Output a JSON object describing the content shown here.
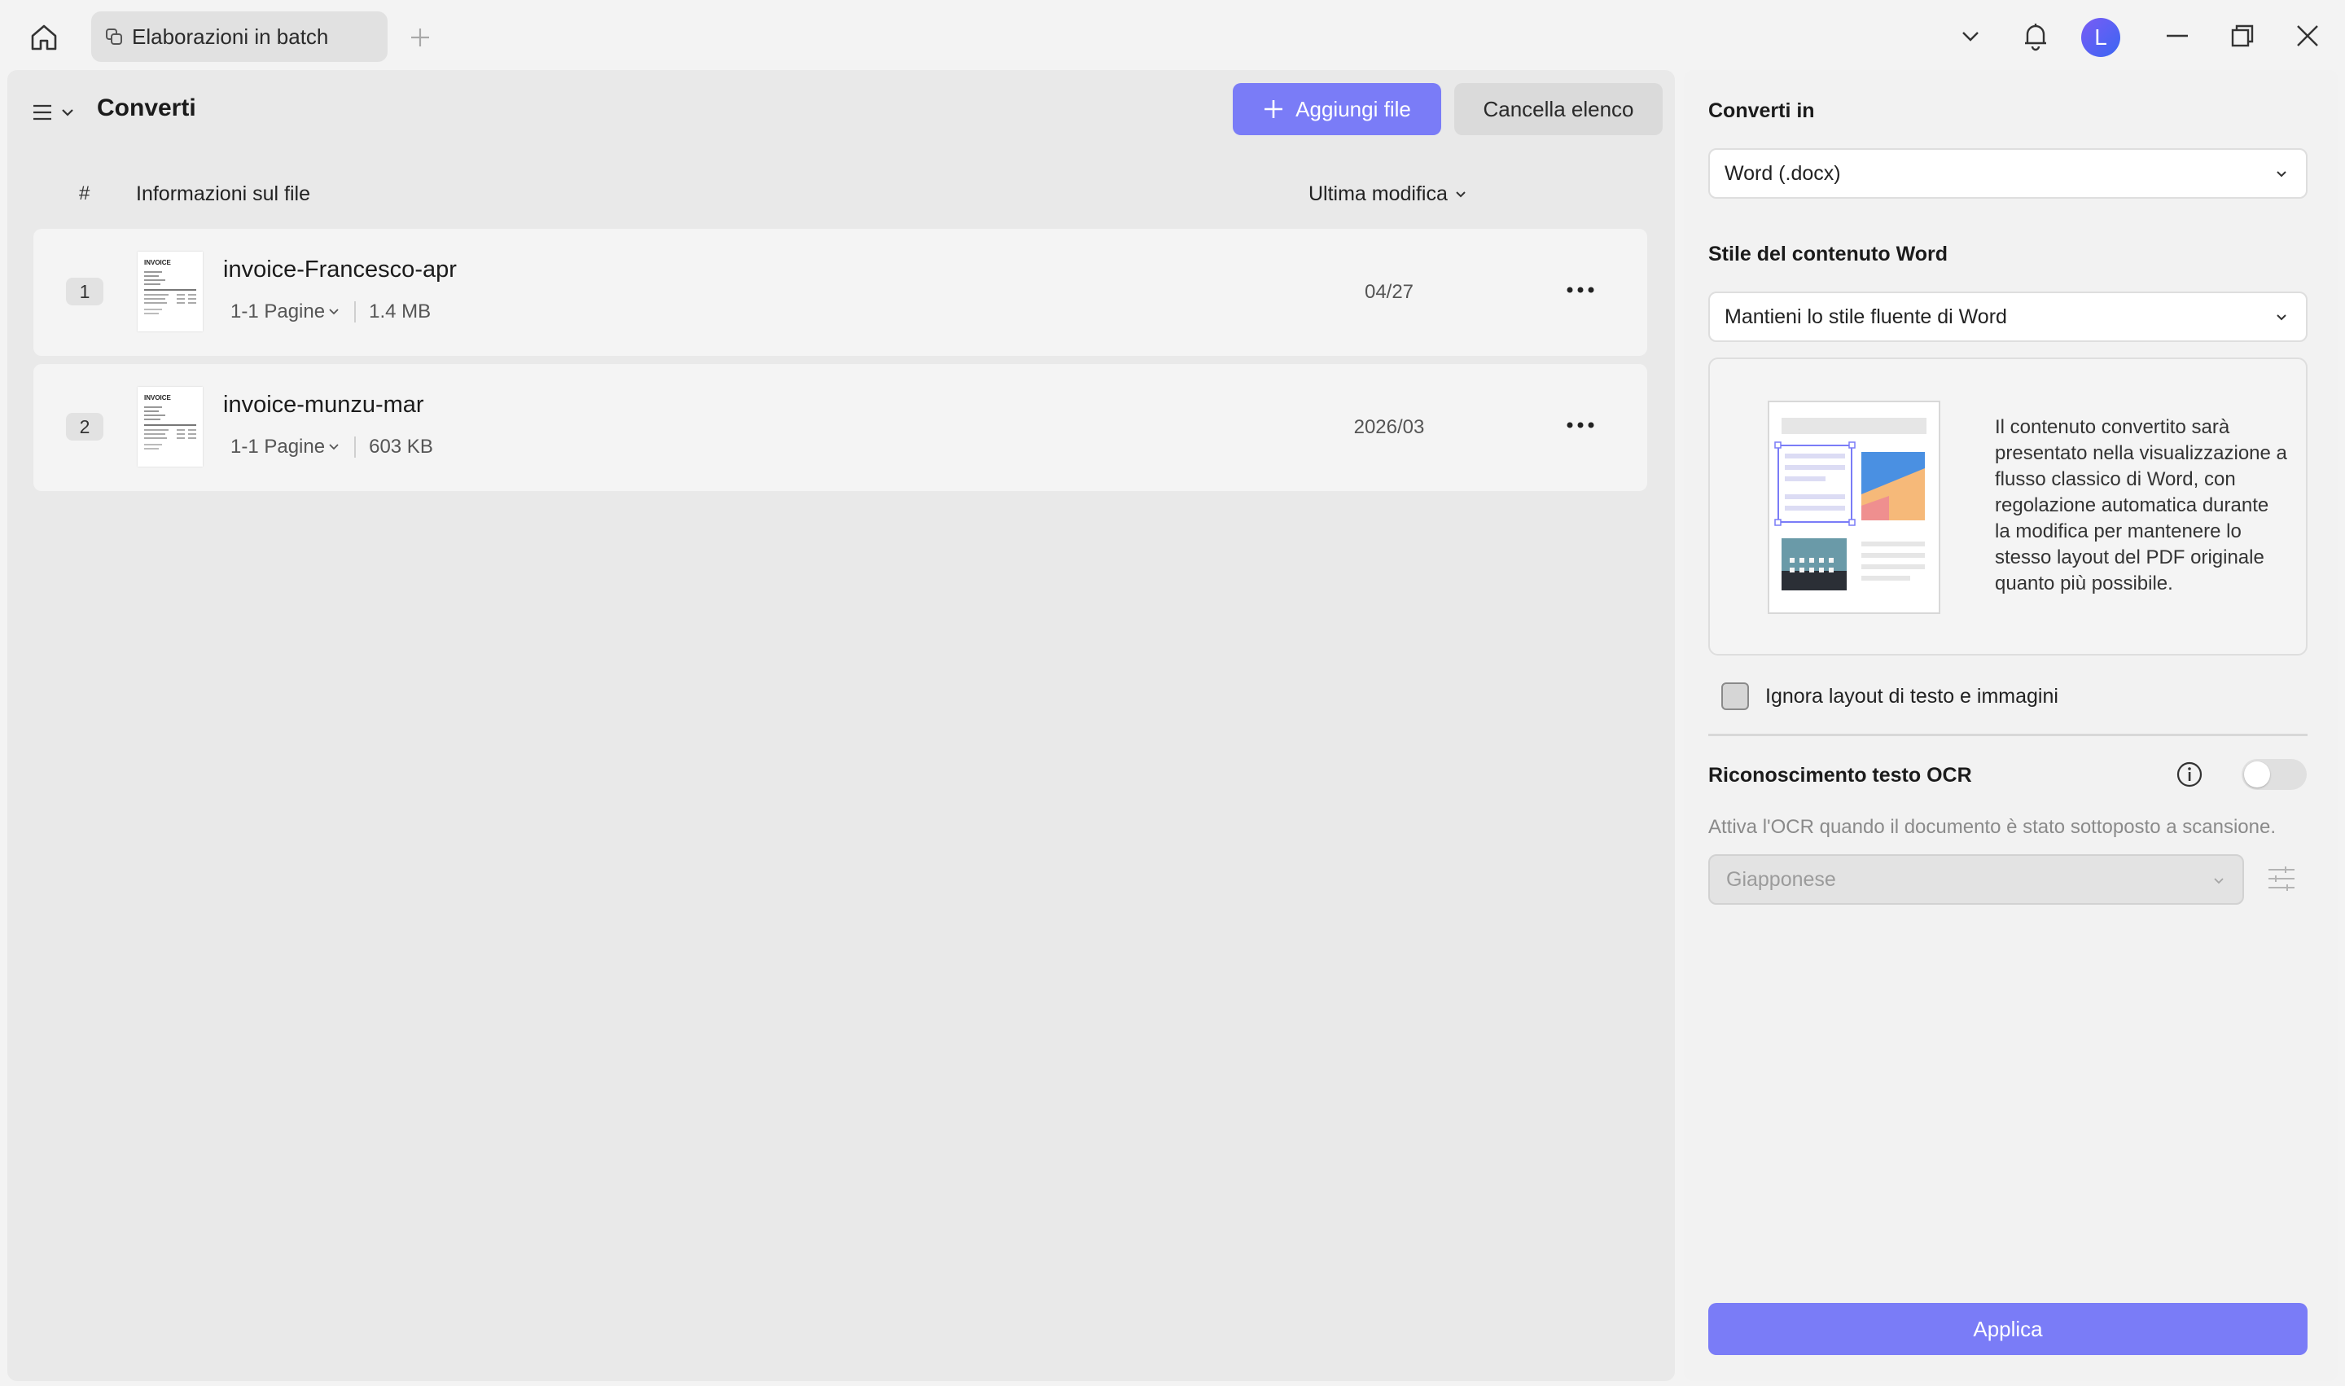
{
  "titlebar": {
    "tab_label": "Elaborazioni in batch",
    "avatar_initial": "L",
    "icons": [
      "home-icon",
      "batch-icon",
      "plus-icon",
      "chevron-down-icon",
      "bell-icon",
      "minimize-icon",
      "restore-icon",
      "close-icon"
    ]
  },
  "left": {
    "title": "Converti",
    "add_files_label": "Aggiungi file",
    "clear_list_label": "Cancella elenco",
    "columns": {
      "hash": "#",
      "info": "Informazioni sul file",
      "modified": "Ultima modifica"
    },
    "files": [
      {
        "index": "1",
        "name": "invoice-Francesco-apr",
        "pages": "1-1 Pagine",
        "size": "1.4 MB",
        "date": "04/27"
      },
      {
        "index": "2",
        "name": "invoice-munzu-mar",
        "pages": "1-1 Pagine",
        "size": "603 KB",
        "date": "2026/03"
      }
    ],
    "thumb_heading": "INVOICE"
  },
  "right": {
    "convert_to_label": "Converti in",
    "convert_to_value": "Word (.docx)",
    "word_style_label": "Stile del contenuto Word",
    "word_style_value": "Mantieni lo stile fluente di Word",
    "preview_text": "Il contenuto convertito sarà presentato nella visualizzazione a flusso classico di Word, con regolazione automatica durante la modifica per mantenere lo stesso layout del PDF originale quanto più possibile.",
    "ignore_layout_label": "Ignora layout di testo e immagini",
    "ignore_layout_checked": false,
    "ocr_title": "Riconoscimento testo OCR",
    "ocr_enabled": false,
    "ocr_description": "Attiva l'OCR quando il documento è stato sottoposto a scansione.",
    "ocr_language": "Giapponese",
    "apply_label": "Applica"
  },
  "colors": {
    "accent": "#7a7cf7",
    "panel_left": "#e9e9e9",
    "panel_right": "#f2f2f2",
    "avatar_start": "#7a5cf5",
    "avatar_end": "#3a66f2"
  }
}
